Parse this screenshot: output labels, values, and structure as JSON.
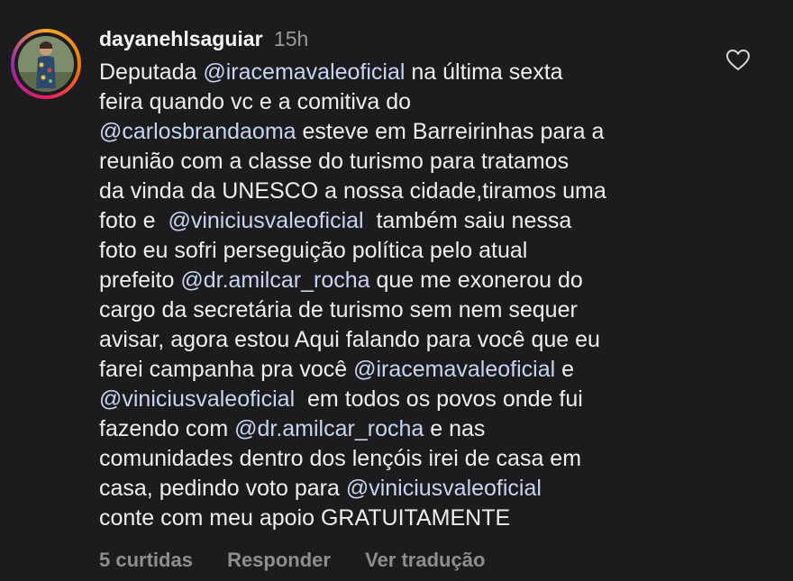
{
  "comment": {
    "username": "dayanehlsaguiar",
    "time": "15h",
    "lines": [
      [
        {
          "t": "Deputada "
        },
        {
          "m": "@iracemavaleoficial"
        },
        {
          "t": " na última sexta"
        }
      ],
      [
        {
          "t": "feira quando vc e a comitiva do"
        }
      ],
      [
        {
          "m": "@carlosbrandaoma"
        },
        {
          "t": " esteve em Barreirinhas para a"
        }
      ],
      [
        {
          "t": "reunião com a classe do turismo para tratamos"
        }
      ],
      [
        {
          "t": "da vinda da UNESCO a nossa cidade,tiramos uma"
        }
      ],
      [
        {
          "t": "foto e  "
        },
        {
          "m": "@viniciusvaleoficial"
        },
        {
          "t": "  também saiu nessa"
        }
      ],
      [
        {
          "t": "foto eu sofri perseguição política pelo atual"
        }
      ],
      [
        {
          "t": "prefeito "
        },
        {
          "m": "@dr.amilcar_rocha"
        },
        {
          "t": " que me exonerou do"
        }
      ],
      [
        {
          "t": "cargo da secretária de turismo sem nem sequer"
        }
      ],
      [
        {
          "t": "avisar, agora estou Aqui falando para você que eu"
        }
      ],
      [
        {
          "t": "farei campanha pra você "
        },
        {
          "m": "@iracemavaleoficial"
        },
        {
          "t": " e"
        }
      ],
      [
        {
          "m": "@viniciusvaleoficial"
        },
        {
          "t": "  em todos os povos onde fui"
        }
      ],
      [
        {
          "t": "fazendo com "
        },
        {
          "m": "@dr.amilcar_rocha"
        },
        {
          "t": " e nas"
        }
      ],
      [
        {
          "t": "comunidades dentro dos lençóis irei de casa em"
        }
      ],
      [
        {
          "t": "casa, pedindo voto para "
        },
        {
          "m": "@viniciusvaleoficial"
        }
      ],
      [
        {
          "t": "conte com meu apoio GRATUITAMENTE"
        }
      ]
    ],
    "likes_label": "5 curtidas",
    "reply_label": "Responder",
    "translate_label": "Ver tradução",
    "like_icon": "heart-outline-icon",
    "colors": {
      "background": "#1c1c1e",
      "mention": "#c7d6f0",
      "muted": "#8e8e8e"
    }
  }
}
